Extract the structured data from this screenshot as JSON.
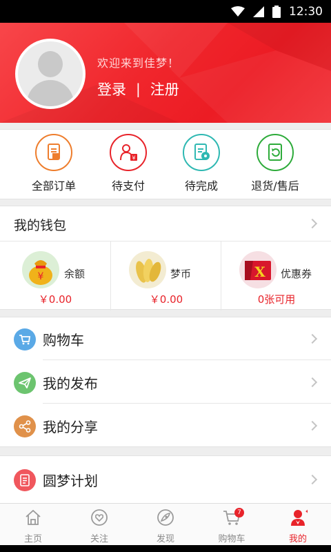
{
  "status_bar": {
    "time": "12:30"
  },
  "header": {
    "welcome": "欢迎来到佳梦！",
    "login": "登录",
    "separator": "|",
    "register": "注册"
  },
  "orders": [
    {
      "label": "全部订单",
      "icon": "all-orders-icon",
      "color": "#ee7d2c"
    },
    {
      "label": "待支付",
      "icon": "pending-payment-icon",
      "color": "#e8232a"
    },
    {
      "label": "待完成",
      "icon": "pending-complete-icon",
      "color": "#2eb8b2"
    },
    {
      "label": "退货/售后",
      "icon": "return-service-icon",
      "color": "#2dab3a"
    }
  ],
  "wallet": {
    "title": "我的钱包",
    "items": [
      {
        "name": "余额",
        "value": "￥0.00",
        "icon": "money-bag-icon"
      },
      {
        "name": "梦币",
        "value": "￥0.00",
        "icon": "coins-icon"
      },
      {
        "name": "优惠券",
        "value": "0张可用",
        "icon": "coupon-icon"
      }
    ]
  },
  "menu": [
    {
      "label": "购物车",
      "icon": "cart-icon",
      "color": "#5aa9e6"
    },
    {
      "label": "我的发布",
      "icon": "paper-plane-icon",
      "color": "#6cc46f"
    },
    {
      "label": "我的分享",
      "icon": "share-icon",
      "color": "#e0914a"
    }
  ],
  "menu2": [
    {
      "label": "圆梦计划",
      "icon": "plan-document-icon",
      "color": "#f0575d"
    }
  ],
  "tabs": [
    {
      "label": "主页",
      "icon": "home-icon"
    },
    {
      "label": "关注",
      "icon": "follow-heart-icon"
    },
    {
      "label": "发现",
      "icon": "discover-icon"
    },
    {
      "label": "购物车",
      "icon": "cart-icon",
      "badge": "7"
    },
    {
      "label": "我的",
      "icon": "profile-icon",
      "active": true
    }
  ],
  "colors": {
    "brand_red": "#e8232a",
    "background": "#eeeeee"
  }
}
